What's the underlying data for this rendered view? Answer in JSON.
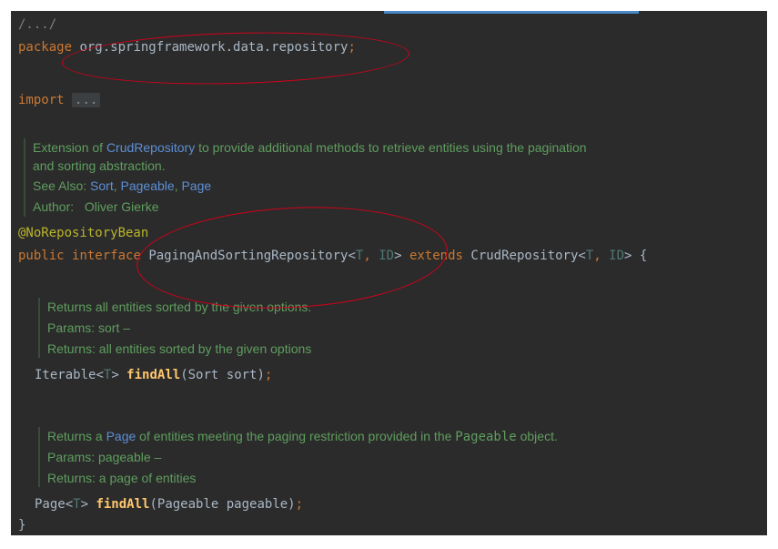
{
  "comment_header": "/.../",
  "package": {
    "keyword": "package",
    "name": "org.springframework.data.repository",
    "semicolon": ";"
  },
  "import": {
    "keyword": "import",
    "folded": "..."
  },
  "class_doc": {
    "line1_pre": "Extension of ",
    "line1_link": "CrudRepository",
    "line1_post": " to provide additional methods to retrieve entities using the pagination",
    "line2": "and sorting abstraction.",
    "see_also_label": "See Also: ",
    "see_also": [
      "Sort",
      "Pageable",
      "Page"
    ],
    "author_label": "Author:",
    "author": "Oliver Gierke"
  },
  "annotation": "@NoRepositoryBean",
  "interface_decl": {
    "kw1": "public",
    "kw2": "interface",
    "name": "PagingAndSortingRepository",
    "type_param_1": "T",
    "type_param_2": "ID",
    "extends_kw": "extends",
    "parent": "CrudRepository",
    "brace": "{"
  },
  "method1_doc": {
    "summary": "Returns all entities sorted by the given options.",
    "params": "Params: sort –",
    "returns": "Returns: all entities sorted by the given options"
  },
  "method1": {
    "return_type": "Iterable",
    "type_param": "T",
    "name": "findAll",
    "args": "(Sort sort)",
    "semicolon": ";"
  },
  "method2_doc": {
    "summary_pre": "Returns a ",
    "summary_link": "Page",
    "summary_post": " of entities meeting the paging restriction provided in the ",
    "summary_code": "Pageable",
    "summary_end": " object.",
    "params": "Params: pageable –",
    "returns": "Returns: a page of entities"
  },
  "method2": {
    "return_type": "Page",
    "type_param": "T",
    "name": "findAll",
    "args": "(Pageable pageable)",
    "semicolon": ";"
  },
  "closing_brace": "}",
  "colors": {
    "background": "#2b2b2b",
    "keyword": "#cc7832",
    "annotation": "#bbb529",
    "doc": "#5f9e5f",
    "link": "#5c8fd6",
    "highlight_circle": "#d0021b"
  }
}
